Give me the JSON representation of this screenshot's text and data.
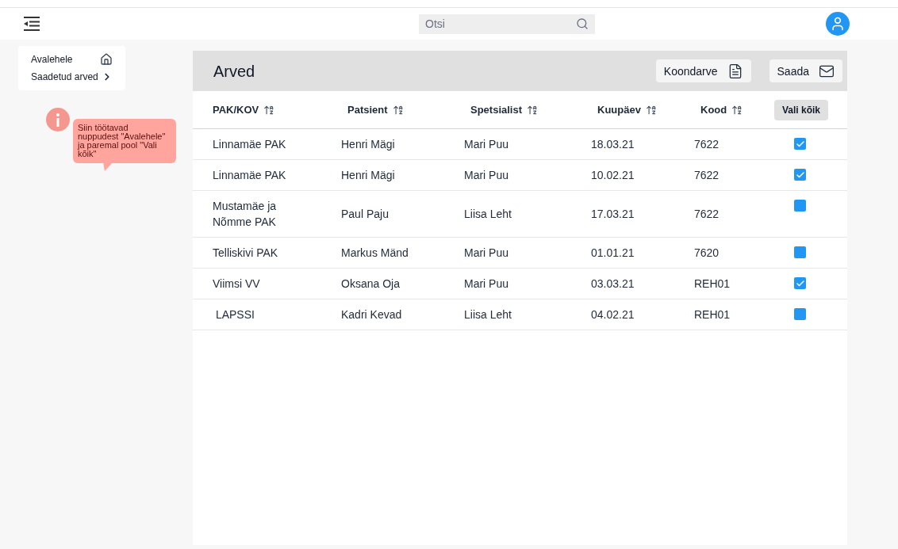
{
  "search": {
    "placeholder": "Otsi"
  },
  "sidebar": {
    "items": [
      {
        "label": "Avalehele",
        "kind": "home"
      },
      {
        "label": "Saadetud arved",
        "kind": "chevron"
      }
    ]
  },
  "info_note": {
    "text": "Siin töötavad nuppudest \"Avalehele\" ja paremal pool \"Vali kõik\""
  },
  "panel": {
    "title": "Arved",
    "buttons": [
      {
        "label": "Koondarve",
        "kind": "report"
      },
      {
        "label": "Saada",
        "kind": "mail"
      }
    ]
  },
  "table": {
    "columns": [
      "PAK/KOV",
      "Patsient",
      "Spetsialist",
      "Kuupäev",
      "Kood"
    ],
    "select_all": "Vali kõik",
    "rows": [
      {
        "cells": [
          "Linnamäe PAK",
          "Henri Mägi",
          "Mari Puu",
          "18.03.21",
          "7622"
        ],
        "checked": true
      },
      {
        "cells": [
          "Linnamäe PAK",
          "Henri Mägi",
          "Mari Puu",
          "10.02.21",
          "7622"
        ],
        "checked": true
      },
      {
        "cells": [
          "Mustamäe ja Nõmme PAK",
          "Paul Paju",
          "Liisa Leht",
          "17.03.21",
          "7622"
        ],
        "checked": false
      },
      {
        "cells": [
          "Telliskivi PAK",
          "Markus Mänd",
          "Mari Puu",
          "01.01.21",
          "7620"
        ],
        "checked": false
      },
      {
        "cells": [
          "Viimsi VV",
          "Oksana Oja",
          "Mari Puu",
          "03.03.21",
          "REH01"
        ],
        "checked": true
      },
      {
        "cells": [
          " LAPSSI",
          "Kadri Kevad",
          "Liisa Leht",
          "04.02.21",
          "REH01"
        ],
        "checked": false
      }
    ]
  }
}
